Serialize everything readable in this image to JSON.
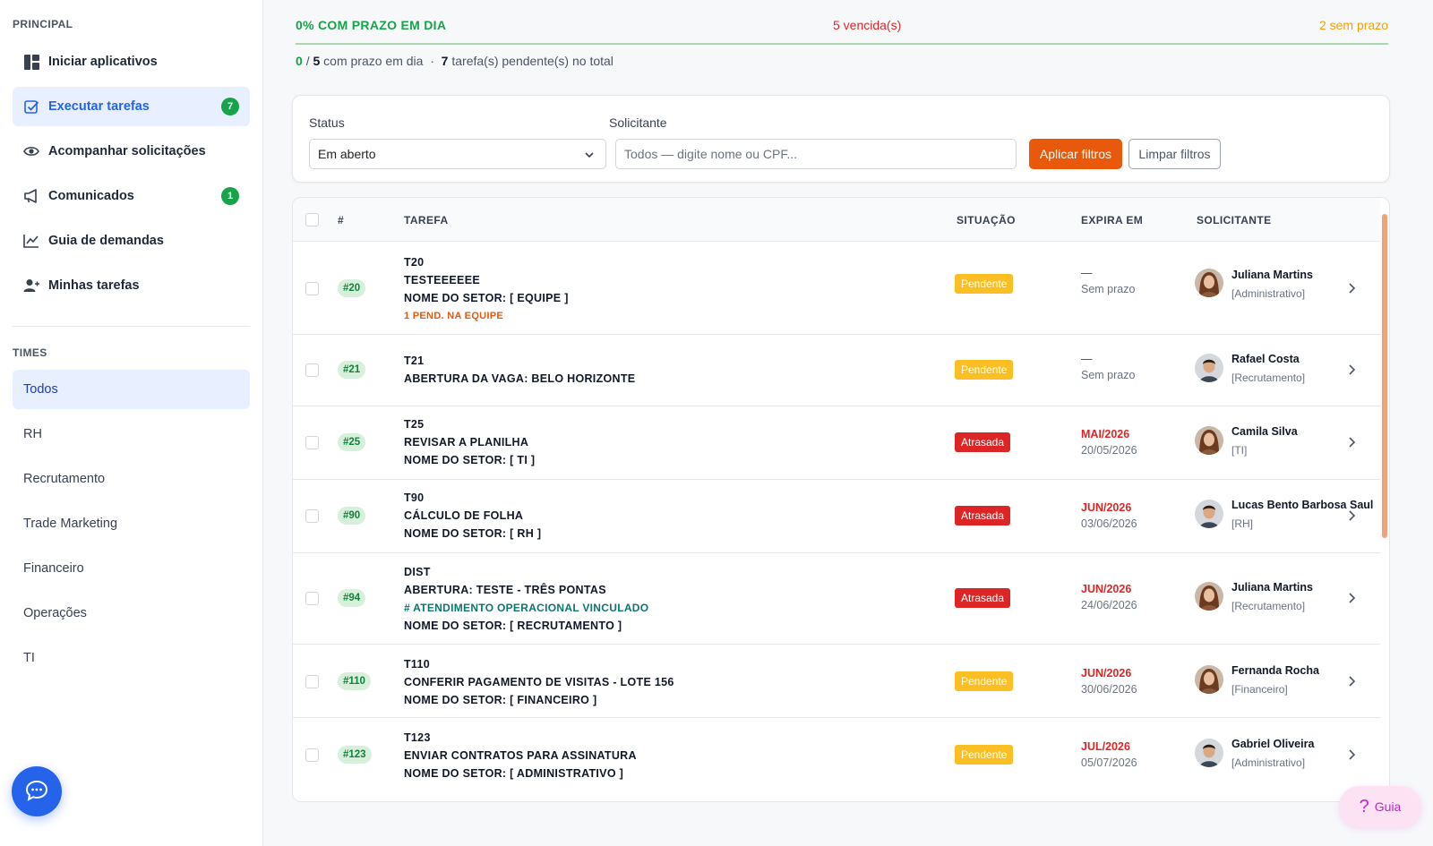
{
  "sidebar": {
    "principal_title": "PRINCIPAL",
    "nav": [
      {
        "label": "Iniciar aplicativos",
        "icon": "dashboard-icon"
      },
      {
        "label": "Executar tarefas",
        "icon": "checkbox-icon",
        "badge": "7",
        "active": true
      },
      {
        "label": "Acompanhar solicitações",
        "icon": "eye-icon"
      },
      {
        "label": "Comunicados",
        "icon": "megaphone-icon",
        "badge": "1"
      },
      {
        "label": "Guia de demandas",
        "icon": "chart-line-icon"
      },
      {
        "label": "Minhas tarefas",
        "icon": "user-check-icon"
      }
    ],
    "times_title": "TIMES",
    "teams": [
      "Todos",
      "RH",
      "Recrutamento",
      "Trade Marketing",
      "Financeiro",
      "Operações",
      "TI"
    ]
  },
  "stats": {
    "on_time": "0% COM PRAZO EM DIA",
    "overdue": "5 vencida(s)",
    "no_deadline": "2 sem prazo"
  },
  "summary": {
    "done": "0",
    "slash": "/",
    "total": "5",
    "text1": "com prazo em dia",
    "sep": "·",
    "pending": "7",
    "text2": "tarefa(s) pendente(s) no total"
  },
  "filters": {
    "status_label": "Status",
    "status_value": "Em aberto",
    "requester_label": "Solicitante",
    "requester_placeholder": "Todos — digite nome ou CPF...",
    "apply": "Aplicar filtros",
    "clear": "Limpar filtros"
  },
  "table": {
    "headers": {
      "num": "#",
      "task": "TAREFA",
      "status": "SITUAÇÃO",
      "expires": "EXPIRA EM",
      "requester": "SOLICITANTE"
    },
    "rows": [
      {
        "id": "#20",
        "lines": [
          "T20",
          "TESTEEEEEE",
          "NOME DO SETOR: [ EQUIPE ]"
        ],
        "note": "1 PEND. NA EQUIPE",
        "status": "Pendente",
        "exp1": "—",
        "exp2": "Sem prazo",
        "name": "Juliana Martins",
        "sector": "[Administrativo]",
        "avatar": "female"
      },
      {
        "id": "#21",
        "lines": [
          "T21",
          "ABERTURA DA VAGA: BELO HORIZONTE"
        ],
        "status": "Pendente",
        "exp1": "—",
        "exp2": "Sem prazo",
        "name": "Rafael Costa",
        "sector": "[Recrutamento]",
        "avatar": "male"
      },
      {
        "id": "#25",
        "lines": [
          "T25",
          "REVISAR A PLANILHA",
          "NOME DO SETOR: [ TI ]"
        ],
        "status": "Atrasada",
        "exp1": "MAI/2026",
        "exp2": "20/05/2026",
        "name": "Camila Silva",
        "sector": "[TI]",
        "avatar": "female"
      },
      {
        "id": "#90",
        "lines": [
          "T90",
          "CÁLCULO DE FOLHA",
          "NOME DO SETOR: [ RH ]"
        ],
        "status": "Atrasada",
        "exp1": "JUN/2026",
        "exp2": "03/06/2026",
        "name": "Lucas Bento Barbosa Saul",
        "sector": "[RH]",
        "avatar": "male"
      },
      {
        "id": "#94",
        "lines": [
          "DIST",
          "ABERTURA: TESTE - TRÊS PONTAS"
        ],
        "link": "# ATENDIMENTO OPERACIONAL VINCULADO",
        "last": "NOME DO SETOR: [ RECRUTAMENTO ]",
        "status": "Atrasada",
        "exp1": "JUN/2026",
        "exp2": "24/06/2026",
        "name": "Juliana Martins",
        "sector": "[Recrutamento]",
        "avatar": "female"
      },
      {
        "id": "#110",
        "lines": [
          "T110",
          "CONFERIR PAGAMENTO DE VISITAS - LOTE 156",
          "NOME DO SETOR: [ FINANCEIRO ]"
        ],
        "status": "Pendente",
        "exp1": "JUN/2026",
        "exp2": "30/06/2026",
        "name": "Fernanda Rocha",
        "sector": "[Financeiro]",
        "avatar": "female"
      },
      {
        "id": "#123",
        "lines": [
          "T123",
          "ENVIAR CONTRATOS PARA ASSINATURA",
          "NOME DO SETOR: [ ADMINISTRATIVO ]"
        ],
        "status": "Pendente",
        "exp1": "JUL/2026",
        "exp2": "05/07/2026",
        "name": "Gabriel Oliveira",
        "sector": "[Administrativo]",
        "avatar": "male"
      }
    ]
  },
  "guia_label": "Guia",
  "colors": {
    "accent": "#2563eb",
    "success": "#16a34a",
    "danger": "#dc2626",
    "warning": "#fbbf24",
    "apply": "#e8590c"
  }
}
